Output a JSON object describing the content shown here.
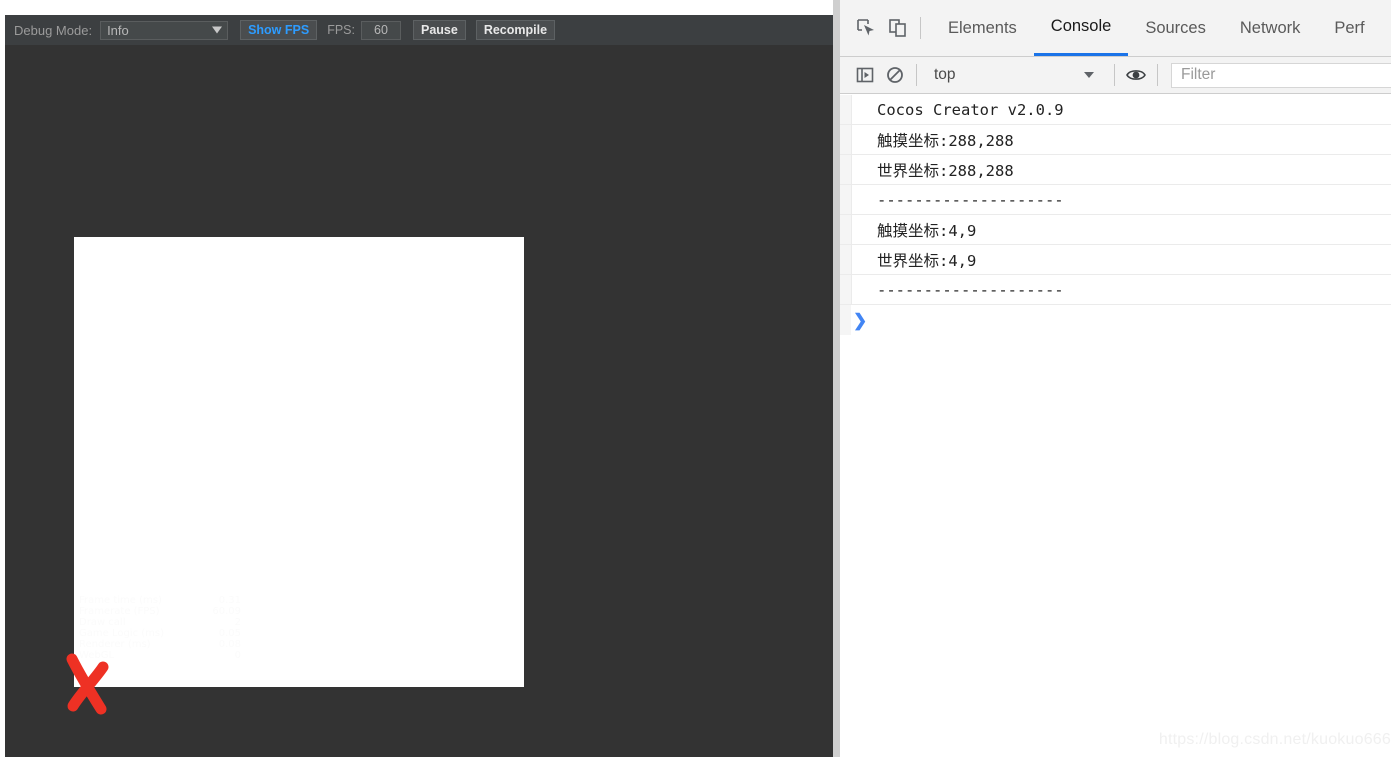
{
  "preview_toolbar": {
    "debug_mode_label": "Debug Mode:",
    "debug_mode_value": "Info",
    "debug_mode_options": [
      "Info"
    ],
    "show_fps_label": "Show FPS",
    "fps_label": "FPS:",
    "fps_value": "60",
    "pause_label": "Pause",
    "recompile_label": "Recompile",
    "accent_color": "#2d9cff",
    "background_color": "#3c3f41"
  },
  "stage": {
    "background_color": "#333333",
    "canvas_background_color": "#ffffff",
    "annotation": {
      "name": "red-x-mark",
      "color": "#ee3124"
    }
  },
  "profiler": {
    "rows": [
      {
        "label": "Frame time (ms)",
        "value": "0.31"
      },
      {
        "label": "Framerate (FPS)",
        "value": "60.09"
      },
      {
        "label": "Draw call",
        "value": "2"
      },
      {
        "label": "Game Logic (ms)",
        "value": "0.05"
      },
      {
        "label": "Renderer (ms)",
        "value": "0.08"
      },
      {
        "label": "WebGL",
        "value": "0"
      }
    ]
  },
  "devtools": {
    "icons": {
      "inspect": "inspect-element-icon",
      "device": "device-toolbar-icon"
    },
    "tabs": [
      {
        "label": "Elements",
        "active": false
      },
      {
        "label": "Console",
        "active": true
      },
      {
        "label": "Sources",
        "active": false
      },
      {
        "label": "Network",
        "active": false
      },
      {
        "label": "Perf",
        "active": false
      }
    ],
    "active_tab_underline_color": "#1a73e8",
    "console_toolbar": {
      "sidebar_icon": "console-sidebar-icon",
      "clear_icon": "clear-console-icon",
      "context_value": "top",
      "eye_icon": "live-expression-eye-icon",
      "filter_placeholder": "Filter"
    },
    "console_messages": [
      "Cocos Creator v2.0.9",
      "触摸坐标:288,288",
      "世界坐标:288,288",
      "--------------------",
      "触摸坐标:4,9",
      "世界坐标:4,9",
      "--------------------"
    ],
    "prompt_symbol": "❯"
  },
  "watermark": {
    "text": "https://blog.csdn.net/kuokuo666"
  }
}
